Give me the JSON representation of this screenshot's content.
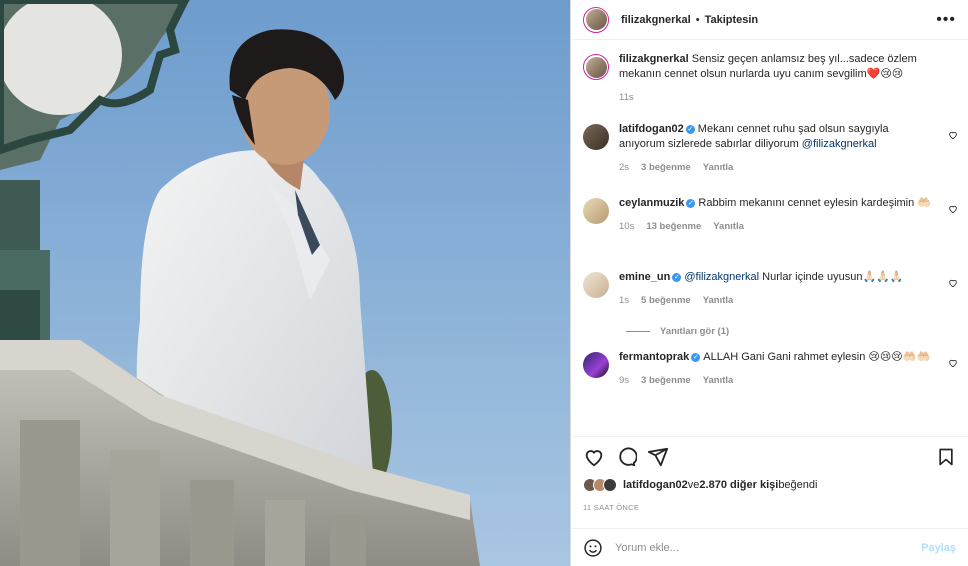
{
  "header": {
    "username": "filizakgnerkal",
    "separator": "•",
    "follow_status": "Takiptesin",
    "more_icon": "ellipsis-icon"
  },
  "caption": {
    "username": "filizakgnerkal",
    "text": "Sensiz geçen anlamsız beş yıl...sadece özlem mekanın cennet olsun nurlarda uyu canım sevgilim❤️😢😢",
    "time": "11s"
  },
  "comments": [
    {
      "username": "latifdogan02",
      "verified": true,
      "text": "Mekanı cennet ruhu şad olsun saygıyla anıyorum sizlerede sabırlar diliyorum ",
      "mention": "@filizakgnerkal",
      "time": "2s",
      "likes": "3 beğenme",
      "reply": "Yanıtla"
    },
    {
      "username": "ceylanmuzik",
      "verified": true,
      "text": "Rabbim mekanını cennet eylesin kardeşimin 🤲🏻",
      "mention": "",
      "time": "10s",
      "likes": "13 beğenme",
      "reply": "Yanıtla"
    },
    {
      "username": "emine_un",
      "verified": true,
      "mention_first": "@filizakgnerkal",
      "text": " Nurlar içinde uyusun🙏🏻🙏🏻🙏🏻",
      "time": "1s",
      "likes": "5 beğenme",
      "reply": "Yanıtla"
    },
    {
      "username": "fermantoprak",
      "verified": true,
      "text": "ALLAH Gani Gani rahmet eylesin 😢😢😢🤲🏻🤲🏻",
      "mention": "",
      "time": "9s",
      "likes": "3 beğenme",
      "reply": "Yanıtla"
    }
  ],
  "view_replies": "Yanıtları gör (1)",
  "likes_line": {
    "user": "latifdogan02",
    "connector": " ve ",
    "count_text": "2.870 diğer kişi",
    "suffix": " beğendi"
  },
  "time_ago": "11 SAAT ÖNCE",
  "add_comment": {
    "placeholder": "Yorum ekle...",
    "post_label": "Paylaş"
  },
  "icons": {
    "like": "heart-icon",
    "comment": "comment-icon",
    "share": "share-icon",
    "save": "bookmark-icon",
    "emoji": "emoji-icon"
  },
  "colors": {
    "link": "#00376b",
    "verified": "#3897f0",
    "secondary_text": "#8e8e8e",
    "post_button": "#b2dffc"
  }
}
